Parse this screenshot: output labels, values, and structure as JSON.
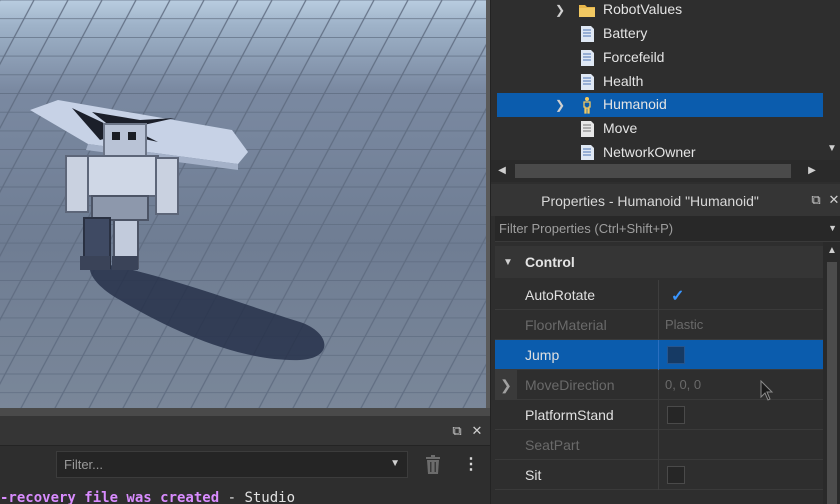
{
  "explorer": {
    "items": [
      {
        "label": "RobotValues",
        "icon": "folder-icon",
        "expandable": true,
        "selected": false
      },
      {
        "label": "Battery",
        "icon": "script-icon",
        "expandable": false,
        "selected": false
      },
      {
        "label": "Forcefeild",
        "icon": "script-icon",
        "expandable": false,
        "selected": false
      },
      {
        "label": "Health",
        "icon": "script-icon",
        "expandable": false,
        "selected": false
      },
      {
        "label": "Humanoid",
        "icon": "humanoid-icon",
        "expandable": true,
        "selected": true
      },
      {
        "label": "Move",
        "icon": "script-icon",
        "expandable": false,
        "selected": false
      },
      {
        "label": "NetworkOwner",
        "icon": "script-icon",
        "expandable": false,
        "selected": false
      }
    ]
  },
  "properties": {
    "title": "Properties - Humanoid \"Humanoid\"",
    "filter_placeholder": "Filter Properties (Ctrl+Shift+P)",
    "section": "Control",
    "rows": [
      {
        "name": "AutoRotate",
        "type": "checkbox",
        "checked": true,
        "enabled": true,
        "selected": false,
        "expandable": false
      },
      {
        "name": "FloorMaterial",
        "type": "text",
        "value": "Plastic",
        "enabled": false,
        "selected": false,
        "expandable": false
      },
      {
        "name": "Jump",
        "type": "checkbox",
        "checked": false,
        "enabled": true,
        "selected": true,
        "expandable": false
      },
      {
        "name": "MoveDirection",
        "type": "text",
        "value": "0, 0, 0",
        "enabled": false,
        "selected": false,
        "expandable": true
      },
      {
        "name": "PlatformStand",
        "type": "checkbox",
        "checked": false,
        "enabled": true,
        "selected": false,
        "expandable": false
      },
      {
        "name": "SeatPart",
        "type": "text",
        "value": "",
        "enabled": false,
        "selected": false,
        "expandable": false
      },
      {
        "name": "Sit",
        "type": "checkbox",
        "checked": false,
        "enabled": true,
        "selected": false,
        "expandable": false
      }
    ]
  },
  "output": {
    "filter_placeholder": "Filter...",
    "line_warning": "-recovery file was created",
    "line_rest": "  -  Studio"
  },
  "colors": {
    "selection": "#0b5cad",
    "panel": "#2e2e2e",
    "checkmark": "#3a96ff",
    "output_warning": "#d98cff"
  }
}
